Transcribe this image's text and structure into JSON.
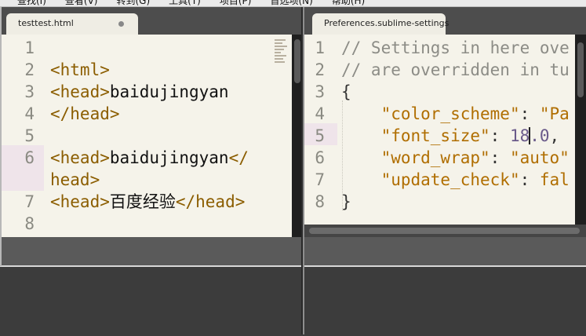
{
  "menu": {
    "items": [
      "查找(I)",
      "查看(V)",
      "转到(G)",
      "工具(T)",
      "项目(P)",
      "首选项(N)",
      "帮助(H)"
    ]
  },
  "left_pane": {
    "tab_title": "testtest.html",
    "tab_state": "modified",
    "lines": [
      {
        "num": "1",
        "segments": []
      },
      {
        "num": "2",
        "segments": [
          {
            "t": "tag",
            "v": "<html>"
          }
        ]
      },
      {
        "num": "3",
        "segments": [
          {
            "t": "tag",
            "v": "<head>"
          },
          {
            "t": "txt",
            "v": "baidujingyan"
          }
        ]
      },
      {
        "num": "4",
        "segments": [
          {
            "t": "tag",
            "v": "</head>"
          }
        ]
      },
      {
        "num": "5",
        "segments": []
      },
      {
        "num": "6",
        "segments": [
          {
            "t": "tag",
            "v": "<head>"
          },
          {
            "t": "txt",
            "v": "baidujingyan"
          },
          {
            "t": "tag",
            "v": "</"
          }
        ]
      },
      {
        "num": "",
        "segments": [
          {
            "t": "tag",
            "v": "head>"
          }
        ]
      },
      {
        "num": "7",
        "segments": [
          {
            "t": "tag",
            "v": "<head>"
          },
          {
            "t": "txt",
            "v": "百度经验"
          },
          {
            "t": "tag",
            "v": "</head>"
          }
        ]
      },
      {
        "num": "8",
        "segments": []
      }
    ],
    "highlighted_line": "6"
  },
  "right_pane": {
    "tab_title": "Preferences.sublime-settings",
    "lines": [
      {
        "num": "1",
        "segments": [
          {
            "t": "cmt",
            "v": "// Settings in here ove"
          }
        ]
      },
      {
        "num": "2",
        "segments": [
          {
            "t": "cmt",
            "v": "// are overridden in tu"
          }
        ]
      },
      {
        "num": "3",
        "segments": [
          {
            "t": "punc",
            "v": "{"
          }
        ]
      },
      {
        "num": "4",
        "segments": [
          {
            "t": "txt",
            "v": "    "
          },
          {
            "t": "str",
            "v": "\"color_scheme\""
          },
          {
            "t": "punc",
            "v": ": "
          },
          {
            "t": "str",
            "v": "\"Pa"
          }
        ]
      },
      {
        "num": "5",
        "segments": [
          {
            "t": "txt",
            "v": "    "
          },
          {
            "t": "str",
            "v": "\"font_size\""
          },
          {
            "t": "punc",
            "v": ": "
          },
          {
            "t": "num",
            "v": "18"
          },
          {
            "t": "cursor",
            "v": ""
          },
          {
            "t": "num",
            "v": ".0"
          },
          {
            "t": "punc",
            "v": ","
          }
        ]
      },
      {
        "num": "6",
        "segments": [
          {
            "t": "txt",
            "v": "    "
          },
          {
            "t": "str",
            "v": "\"word_wrap\""
          },
          {
            "t": "punc",
            "v": ": "
          },
          {
            "t": "str",
            "v": "\"auto\""
          }
        ]
      },
      {
        "num": "7",
        "segments": [
          {
            "t": "txt",
            "v": "    "
          },
          {
            "t": "str",
            "v": "\"update_check\""
          },
          {
            "t": "punc",
            "v": ": "
          },
          {
            "t": "str",
            "v": "fal"
          }
        ]
      },
      {
        "num": "8",
        "segments": [
          {
            "t": "punc",
            "v": "}"
          }
        ]
      }
    ],
    "highlighted_line": "5"
  },
  "colors": {
    "editor_bg": "#f5f3ea",
    "tag": "#8b5d00",
    "comment": "#8c8c86",
    "string": "#b06e00",
    "number": "#6a5a8a",
    "line_highlight": "#efe4ea"
  },
  "icons": [
    "unsaved-dot-icon",
    "minimap-icon"
  ]
}
